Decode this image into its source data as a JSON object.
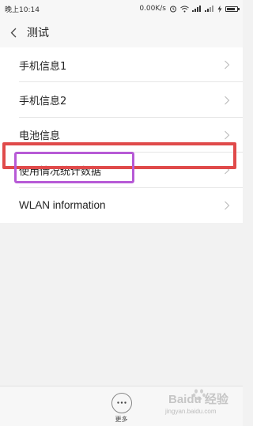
{
  "status_bar": {
    "time": "晚上10:14",
    "net_speed": "0.00K/s"
  },
  "header": {
    "title": "测试"
  },
  "list": {
    "items": [
      {
        "label": "手机信息1"
      },
      {
        "label": "手机信息2"
      },
      {
        "label": "电池信息"
      },
      {
        "label": "使用情况统计数据"
      },
      {
        "label": "WLAN information"
      }
    ]
  },
  "bottom_bar": {
    "more_label": "更多"
  },
  "watermark": {
    "brand": "Baidu 经验",
    "url": "jingyan.baidu.com"
  },
  "colors": {
    "highlight_red": "#e04a4a",
    "highlight_purple": "#b75ad6"
  },
  "icons": [
    "back-arrow-icon",
    "alarm-icon",
    "wifi-icon",
    "signal-icon",
    "battery-icon",
    "chevron-right-icon",
    "more-dots-icon",
    "baidu-paw-icon"
  ]
}
